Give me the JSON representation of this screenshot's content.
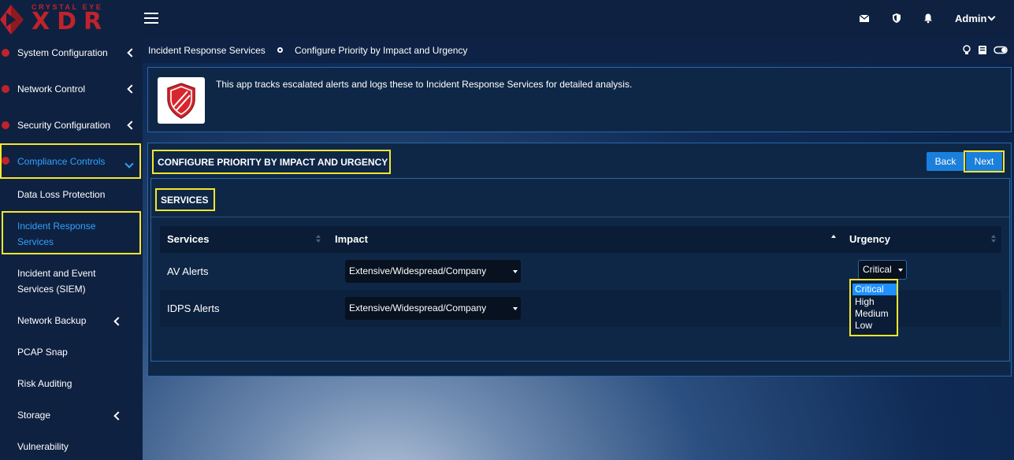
{
  "brand": {
    "small": "CRYSTAL EYE",
    "big": "XDR"
  },
  "topbar": {
    "user": "Admin",
    "icons": [
      "mail-icon",
      "shield-icon",
      "bell-icon"
    ]
  },
  "sidebar": {
    "items": [
      {
        "label": "System Configuration"
      },
      {
        "label": "Network Control"
      },
      {
        "label": "Security Configuration"
      },
      {
        "label": "Compliance Controls"
      }
    ],
    "subitems": [
      {
        "label": "Data Loss Protection"
      },
      {
        "label_line1": "Incident Response",
        "label_line2": "Services"
      },
      {
        "label_line1": "Incident and Event",
        "label_line2": "Services (SIEM)"
      },
      {
        "label": "Network Backup"
      },
      {
        "label": "PCAP Snap"
      },
      {
        "label": "Risk Auditing"
      },
      {
        "label": "Storage"
      },
      {
        "label": "Vulnerability"
      }
    ]
  },
  "breadcrumb": {
    "parent": "Incident Response Services",
    "current": "Configure Priority by Impact and Urgency"
  },
  "info": {
    "text": "This app tracks escalated alerts and logs these to Incident Response Services for detailed analysis."
  },
  "config": {
    "title": "CONFIGURE PRIORITY BY IMPACT AND URGENCY",
    "back_label": "Back",
    "next_label": "Next",
    "services_title": "SERVICES",
    "columns": [
      "Services",
      "Impact",
      "Urgency"
    ],
    "rows": [
      {
        "service": "AV Alerts",
        "impact": "Extensive/Widespread/Company",
        "urgency": "Critical"
      },
      {
        "service": "IDPS Alerts",
        "impact": "Extensive/Widespread/Company",
        "urgency": ""
      }
    ],
    "urgency_options": [
      "Critical",
      "High",
      "Medium",
      "Low"
    ]
  },
  "colors": {
    "accent": "#1b7fdc",
    "highlight": "#f5e62e",
    "brand_red": "#c0232b",
    "active_link": "#2fa3ff"
  }
}
